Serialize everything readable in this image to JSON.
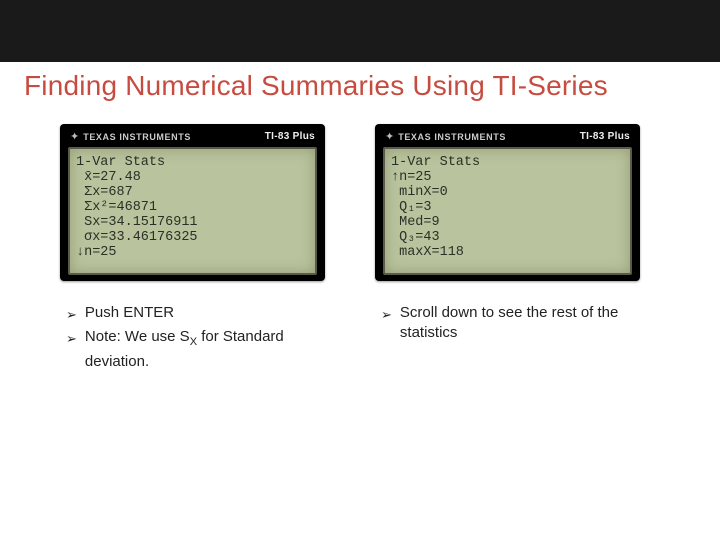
{
  "topbar": {},
  "title": "Finding Numerical Summaries Using TI-Series",
  "calc_left": {
    "brand": "TEXAS INSTRUMENTS",
    "model": "TI-83 Plus",
    "lines": [
      "1-Var Stats",
      " x̄=27.48",
      " Σx=687",
      " Σx²=46871",
      " Sx=34.15176911",
      " σx=33.46176325",
      "↓n=25"
    ]
  },
  "calc_right": {
    "brand": "TEXAS INSTRUMENTS",
    "model": "TI-83 Plus",
    "lines": [
      "1-Var Stats",
      "↑n=25",
      " minX=0",
      " Q₁=3",
      " Med=9",
      " Q₃=43",
      " maxX=118"
    ]
  },
  "bullets_left": {
    "b1": "Push ENTER",
    "b2_prefix": "Note:  We use S",
    "b2_sub": "X",
    "b2_suffix": " for Standard deviation."
  },
  "bullets_right": {
    "b1": "Scroll down to see the rest of the statistics"
  }
}
